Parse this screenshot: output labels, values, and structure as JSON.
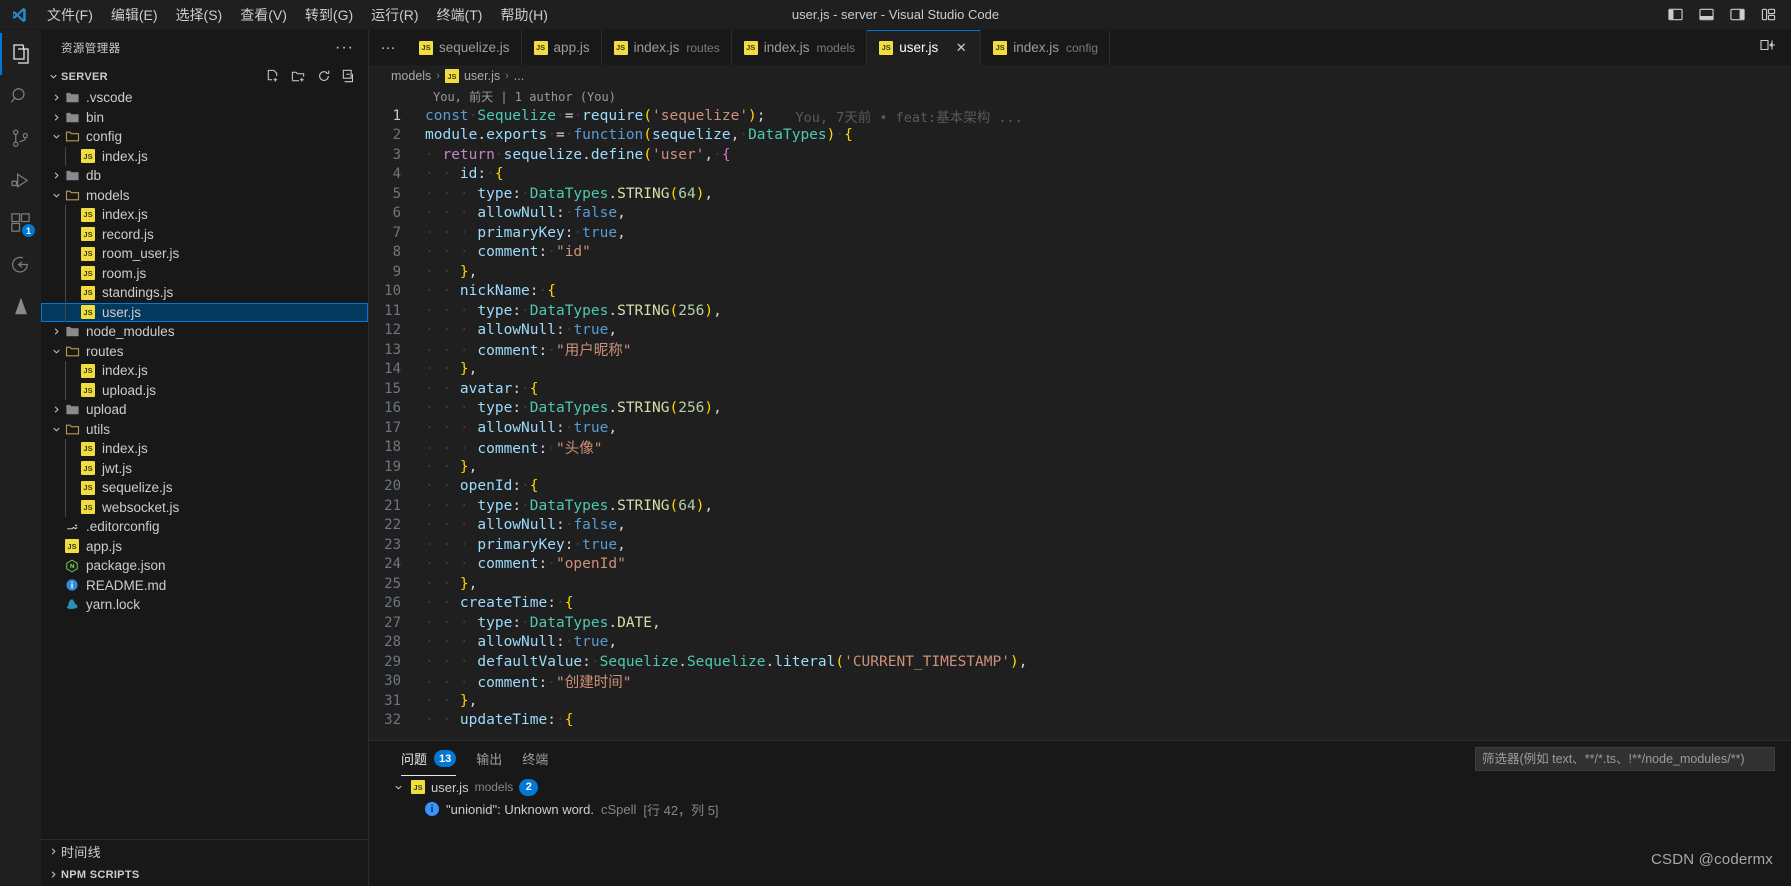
{
  "titlebar": {
    "window_title": "user.js - server - Visual Studio Code",
    "logo_icon": "vscode-logo-icon",
    "menus": [
      {
        "label": "文件(F)",
        "name": "menu-file"
      },
      {
        "label": "编辑(E)",
        "name": "menu-edit"
      },
      {
        "label": "选择(S)",
        "name": "menu-selection"
      },
      {
        "label": "查看(V)",
        "name": "menu-view"
      },
      {
        "label": "转到(G)",
        "name": "menu-go"
      },
      {
        "label": "运行(R)",
        "name": "menu-run"
      },
      {
        "label": "终端(T)",
        "name": "menu-terminal"
      },
      {
        "label": "帮助(H)",
        "name": "menu-help"
      }
    ],
    "layout_actions": [
      {
        "name": "toggle-primary-sidebar-icon"
      },
      {
        "name": "toggle-panel-icon"
      },
      {
        "name": "toggle-secondary-sidebar-icon"
      },
      {
        "name": "customize-layout-icon"
      }
    ]
  },
  "activitybar": {
    "items": [
      {
        "name": "activity-explorer",
        "icon": "files-icon",
        "active": true,
        "badge": ""
      },
      {
        "name": "activity-search",
        "icon": "search-icon",
        "active": false,
        "badge": ""
      },
      {
        "name": "activity-source-control",
        "icon": "source-control-icon",
        "active": false,
        "badge": ""
      },
      {
        "name": "activity-run-debug",
        "icon": "run-and-debug-icon",
        "active": false,
        "badge": ""
      },
      {
        "name": "activity-extensions",
        "icon": "extensions-icon",
        "active": false,
        "badge": "1"
      },
      {
        "name": "activity-remote",
        "icon": "remote-explorer-icon",
        "active": false,
        "badge": ""
      },
      {
        "name": "activity-testing",
        "icon": "beaker-icon",
        "active": false,
        "badge": ""
      }
    ]
  },
  "sidebar": {
    "title": "资源管理器",
    "more_actions": "···",
    "root": {
      "label": "SERVER",
      "actions": [
        "new-file-icon",
        "new-folder-icon",
        "refresh-icon",
        "collapse-all-icon"
      ]
    },
    "tree": [
      {
        "label": ".vscode",
        "type": "folder",
        "expanded": false,
        "depth": 1
      },
      {
        "label": "bin",
        "type": "folder",
        "expanded": false,
        "depth": 1
      },
      {
        "label": "config",
        "type": "folder",
        "expanded": true,
        "depth": 1
      },
      {
        "label": "index.js",
        "type": "js",
        "depth": 2
      },
      {
        "label": "db",
        "type": "folder",
        "expanded": false,
        "depth": 1
      },
      {
        "label": "models",
        "type": "folder",
        "expanded": true,
        "depth": 1
      },
      {
        "label": "index.js",
        "type": "js",
        "depth": 2
      },
      {
        "label": "record.js",
        "type": "js",
        "depth": 2
      },
      {
        "label": "room_user.js",
        "type": "js",
        "depth": 2
      },
      {
        "label": "room.js",
        "type": "js",
        "depth": 2
      },
      {
        "label": "standings.js",
        "type": "js",
        "depth": 2
      },
      {
        "label": "user.js",
        "type": "js",
        "depth": 2,
        "selected": true
      },
      {
        "label": "node_modules",
        "type": "folder",
        "expanded": false,
        "depth": 1
      },
      {
        "label": "routes",
        "type": "folder",
        "expanded": true,
        "depth": 1
      },
      {
        "label": "index.js",
        "type": "js",
        "depth": 2
      },
      {
        "label": "upload.js",
        "type": "js",
        "depth": 2
      },
      {
        "label": "upload",
        "type": "folder",
        "expanded": false,
        "depth": 1
      },
      {
        "label": "utils",
        "type": "folder",
        "expanded": true,
        "depth": 1
      },
      {
        "label": "index.js",
        "type": "js",
        "depth": 2
      },
      {
        "label": "jwt.js",
        "type": "js",
        "depth": 2
      },
      {
        "label": "sequelize.js",
        "type": "js",
        "depth": 2
      },
      {
        "label": "websocket.js",
        "type": "js",
        "depth": 2
      },
      {
        "label": ".editorconfig",
        "type": "editorconfig",
        "depth": 1
      },
      {
        "label": "app.js",
        "type": "js",
        "depth": 1
      },
      {
        "label": "package.json",
        "type": "npm",
        "depth": 1
      },
      {
        "label": "README.md",
        "type": "readme",
        "depth": 1
      },
      {
        "label": "yarn.lock",
        "type": "yarn",
        "depth": 1
      }
    ],
    "bottom_sections": [
      {
        "label": "时间线",
        "name": "sidebar-section-timeline"
      },
      {
        "label": "NPM SCRIPTS",
        "name": "sidebar-section-npm-scripts"
      }
    ]
  },
  "tabs": {
    "overflow_icon": "···",
    "items": [
      {
        "label": "sequelize.js",
        "desc": "",
        "active": false
      },
      {
        "label": "app.js",
        "desc": "",
        "active": false
      },
      {
        "label": "index.js",
        "desc": "routes",
        "active": false
      },
      {
        "label": "index.js",
        "desc": "models",
        "active": false
      },
      {
        "label": "user.js",
        "desc": "",
        "active": true,
        "close": "✕"
      },
      {
        "label": "index.js",
        "desc": "config",
        "active": false
      }
    ],
    "right_action": "split-editor-icon"
  },
  "breadcrumbs": {
    "items": [
      "models",
      "user.js",
      "..."
    ],
    "separator": "›"
  },
  "editor": {
    "codelens": "You, 前天 | 1 author (You)",
    "blame": "You, 7天前 • feat:基本架构 ...",
    "lines": [
      {
        "n": 1,
        "text": "const Sequelize = require('sequelize');"
      },
      {
        "n": 2,
        "text": "module.exports = function(sequelize, DataTypes) {"
      },
      {
        "n": 3,
        "text": "  return sequelize.define('user', {"
      },
      {
        "n": 4,
        "text": "    id: {"
      },
      {
        "n": 5,
        "text": "      type: DataTypes.STRING(64),"
      },
      {
        "n": 6,
        "text": "      allowNull: false,"
      },
      {
        "n": 7,
        "text": "      primaryKey: true,"
      },
      {
        "n": 8,
        "text": "      comment: \"id\""
      },
      {
        "n": 9,
        "text": "    },"
      },
      {
        "n": 10,
        "text": "    nickName: {"
      },
      {
        "n": 11,
        "text": "      type: DataTypes.STRING(256),"
      },
      {
        "n": 12,
        "text": "      allowNull: true,"
      },
      {
        "n": 13,
        "text": "      comment: \"用户昵称\""
      },
      {
        "n": 14,
        "text": "    },"
      },
      {
        "n": 15,
        "text": "    avatar: {"
      },
      {
        "n": 16,
        "text": "      type: DataTypes.STRING(256),"
      },
      {
        "n": 17,
        "text": "      allowNull: true,"
      },
      {
        "n": 18,
        "text": "      comment: \"头像\""
      },
      {
        "n": 19,
        "text": "    },"
      },
      {
        "n": 20,
        "text": "    openId: {"
      },
      {
        "n": 21,
        "text": "      type: DataTypes.STRING(64),"
      },
      {
        "n": 22,
        "text": "      allowNull: false,"
      },
      {
        "n": 23,
        "text": "      primaryKey: true,"
      },
      {
        "n": 24,
        "text": "      comment: \"openId\""
      },
      {
        "n": 25,
        "text": "    },"
      },
      {
        "n": 26,
        "text": "    createTime: {"
      },
      {
        "n": 27,
        "text": "      type: DataTypes.DATE,"
      },
      {
        "n": 28,
        "text": "      allowNull: true,"
      },
      {
        "n": 29,
        "text": "      defaultValue: Sequelize.Sequelize.literal('CURRENT_TIMESTAMP'),"
      },
      {
        "n": 30,
        "text": "      comment: \"创建时间\""
      },
      {
        "n": 31,
        "text": "    },"
      },
      {
        "n": 32,
        "text": "    updateTime: {"
      }
    ]
  },
  "panel": {
    "tabs": [
      {
        "label": "问题",
        "badge": "13",
        "active": true,
        "name": "panel-tab-problems"
      },
      {
        "label": "输出",
        "badge": "",
        "active": false,
        "name": "panel-tab-output"
      },
      {
        "label": "终端",
        "badge": "",
        "active": false,
        "name": "panel-tab-terminal"
      }
    ],
    "filter_placeholder": "筛选器(例如 text、**/*.ts、!**/node_modules/**)",
    "filter_value": "",
    "filter_icon": "filter-icon",
    "problems": [
      {
        "file": "user.js",
        "folder": "models",
        "count": "2"
      }
    ],
    "problem_items": [
      {
        "message": "\"unionid\": Unknown word.",
        "source": "cSpell",
        "loc": "[行 42，列 5]"
      }
    ]
  },
  "watermark": "CSDN @codermx",
  "colors": {
    "accent": "#0078d4",
    "editor_bg": "#1f1f1f",
    "sidebar_bg": "#181818",
    "selection": "#04395e"
  }
}
